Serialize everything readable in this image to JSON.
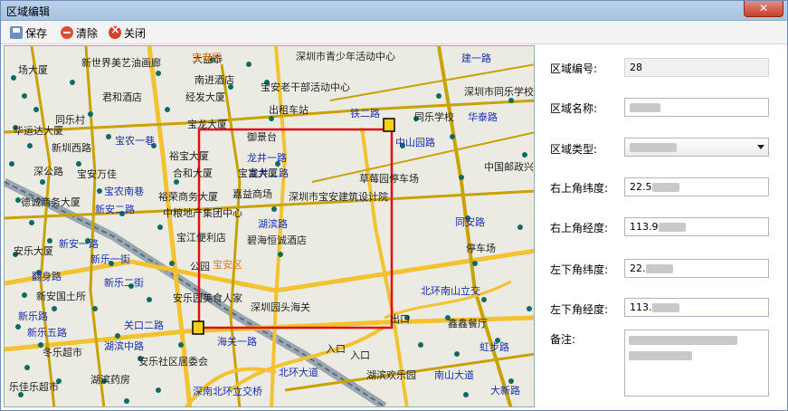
{
  "window": {
    "title": "区域编辑",
    "close_label": "✕"
  },
  "toolbar": {
    "save_label": "保存",
    "clear_label": "清除",
    "close_label": "关闭"
  },
  "map": {
    "labels_blue": [
      "深圳市青少年活动中心",
      "深圳市同乐学校",
      "建一路",
      "新世界美艺油画廊",
      "同乐学校",
      "华泰路",
      "中山园路",
      "中国邮政兴",
      "铁二路",
      "同安路",
      "停车场",
      "北环南山立交",
      "鑫鑫餐厅",
      "虹步路",
      "南山大道",
      "大新路",
      "北环大道",
      "湖滨欢乐园",
      "新安一路",
      "新乐一街",
      "新乐二街",
      "关口二路",
      "湖滨中路",
      "深南北环立交桥",
      "宝农南巷",
      "裕荣商务大厦",
      "新安二路",
      "新乐五路",
      "翻身路",
      "新乐路",
      "宝安区",
      "湖滨路",
      "龙井一路",
      "龙井二路",
      "宝农一巷"
    ],
    "labels_dark": [
      "宝安老干部活动中心",
      "出租车站",
      "御景台",
      "宝富大厦",
      "嘉益商场",
      "深圳市宝安建筑设计院",
      "中粮地产集团中心",
      "碧海恒诚酒店",
      "宝江便利店",
      "公园",
      "安乐园美食人家",
      "深圳园头海关",
      "草莓园停车场",
      "入口",
      "入口",
      "出口",
      "南进酒店",
      "大益泰",
      "君和酒店",
      "宝龙大厦",
      "裕宝大厦",
      "合和大厦",
      "安乐社区居委会",
      "冬乐超市",
      "湖滨药房",
      "乐佳乐超市",
      "新安国土所",
      "安乐大厦",
      "深公路",
      "宝安万佳",
      "德诚商务大厦",
      "新圳西路",
      "同乐村",
      "经发大厦",
      "华运达大厦",
      "场大厦",
      "宝安区"
    ],
    "highlight_road": "海关一路"
  },
  "form": {
    "region_id_label": "区域编号:",
    "region_id_value": "28",
    "region_name_label": "区域名称:",
    "region_type_label": "区域类型:",
    "ne_lat_label": "右上角纬度:",
    "ne_lat_value": "22.5",
    "ne_lng_label": "右上角经度:",
    "ne_lng_value": "113.9",
    "sw_lat_label": "左下角纬度:",
    "sw_lat_value": "22.",
    "sw_lng_label": "左下角经度:",
    "sw_lng_value": "113.",
    "notes_label": "备注:"
  },
  "colors": {
    "selection_rect": "#e01010",
    "road_major": "#f2c230",
    "road_minor": "#c8a200",
    "vehicle_marker": "#0e6b62"
  }
}
